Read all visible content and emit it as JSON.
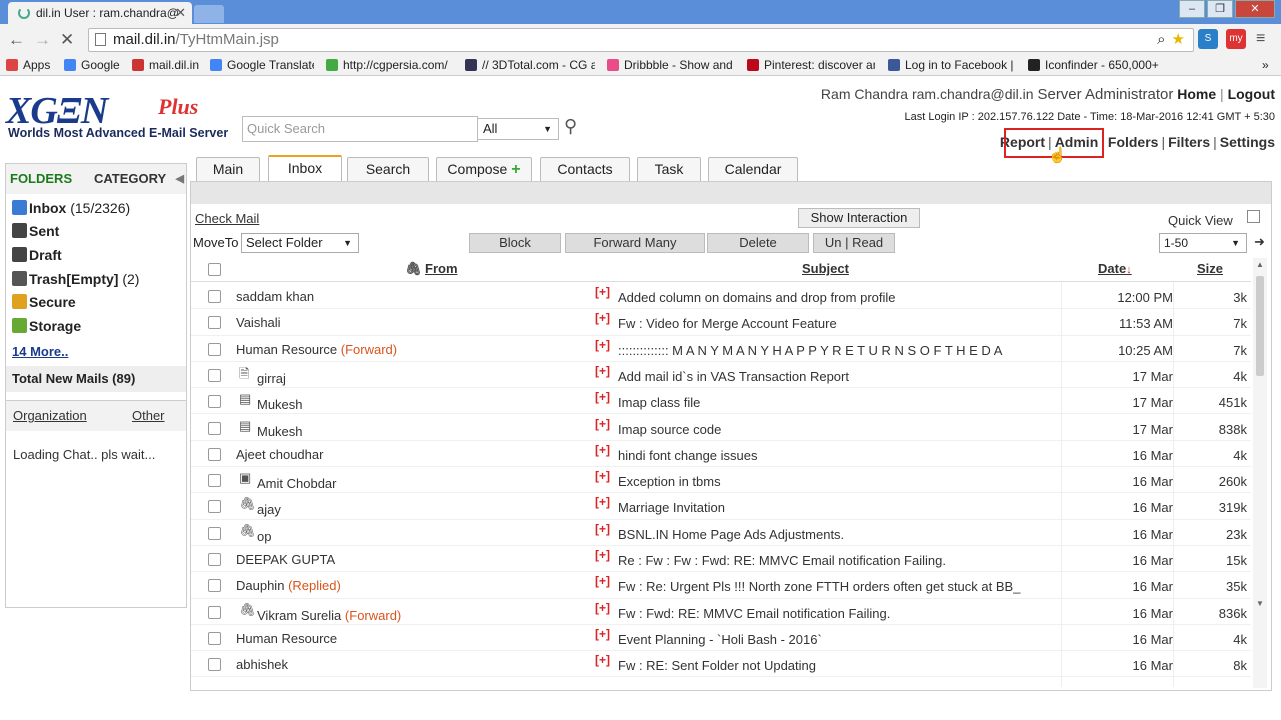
{
  "browser": {
    "tab_title": "dil.in User : ram.chandra@",
    "url_host": "mail.dil.in",
    "url_path": "/TyHtmMain.jsp",
    "ext_label": "my",
    "bookmarks": [
      {
        "label": "Apps",
        "color": "#d44"
      },
      {
        "label": "Google",
        "color": "#4285f4"
      },
      {
        "label": "mail.dil.in",
        "color": "#c33"
      },
      {
        "label": "Google Translate",
        "color": "#4285f4"
      },
      {
        "label": "http://cgpersia.com/",
        "color": "#4a4"
      },
      {
        "label": "// 3DTotal.com - CG a",
        "color": "#335"
      },
      {
        "label": "Dribbble - Show and",
        "color": "#ea4c89"
      },
      {
        "label": "Pinterest: discover anc",
        "color": "#bd081c"
      },
      {
        "label": "Log in to Facebook | F",
        "color": "#3b5998"
      },
      {
        "label": "Iconfinder - 650,000+",
        "color": "#222"
      }
    ]
  },
  "header": {
    "logo_text": "XGENPlus",
    "logo_tagline": "Worlds Most Advanced E-Mail Server",
    "search_placeholder": "Quick Search",
    "search_scope": "All",
    "user_name": "Ram Chandra",
    "user_email": "ram.chandra@dil.in",
    "user_role": "Server Administrator",
    "home_link": "Home",
    "logout_link": "Logout",
    "last_login": "Last Login IP : 202.157.76.122 Date - Time: 18-Mar-2016 12:41 GMT + 5:30",
    "links": [
      "Report",
      "Admin",
      "Folders",
      "Filters",
      "Settings"
    ]
  },
  "sidebar": {
    "folders_label": "FOLDERS",
    "category_label": "CATEGORY",
    "items": [
      {
        "name": "Inbox",
        "count": "(15/2326)",
        "color": "#3a7bd5"
      },
      {
        "name": "Sent",
        "count": "",
        "color": "#444"
      },
      {
        "name": "Draft",
        "count": "",
        "color": "#444"
      },
      {
        "name": "Trash[Empty]",
        "count": "(2)",
        "color": "#555"
      },
      {
        "name": "Secure",
        "count": "",
        "color": "#e0a020"
      },
      {
        "name": "Storage",
        "count": "",
        "color": "#6a3"
      }
    ],
    "more_link": "14 More..",
    "total_new": "Total New Mails (89)",
    "chat_tab_org": "Organization",
    "chat_tab_other": "Other",
    "chat_status": "Loading Chat.. pls wait..."
  },
  "tabs": [
    "Main",
    "Inbox",
    "Search",
    "Compose",
    "Contacts",
    "Task",
    "Calendar"
  ],
  "actions": {
    "check_mail": "Check Mail",
    "show_interaction": "Show Interaction",
    "quick_view": "Quick View",
    "move_to": "MoveTo",
    "select_folder": "Select Folder",
    "block": "Block",
    "forward_many": "Forward Many",
    "delete": "Delete",
    "un": "Un",
    "read": "Read",
    "page_range": "1-50"
  },
  "columns": {
    "from": "From",
    "subject": "Subject",
    "date": "Date",
    "size": "Size"
  },
  "messages": [
    {
      "from": "saddam khan",
      "tag": "",
      "icon": "",
      "subject": "Added column on domains and drop from profile",
      "date": "12:00 PM",
      "size": "3k"
    },
    {
      "from": "Vaishali",
      "tag": "",
      "icon": "",
      "subject": "Fw : Video for Merge Account Feature",
      "date": "11:53 AM",
      "size": "7k"
    },
    {
      "from": "Human Resource",
      "tag": "(Forward)",
      "icon": "",
      "subject": ":::::::::::::: M A N Y M A N Y H A P P Y R E T U R N S O F T H E D A",
      "date": "10:25 AM",
      "size": "7k"
    },
    {
      "from": "girraj",
      "tag": "",
      "icon": "doc",
      "subject": "Add mail id`s in VAS Transaction Report",
      "date": "17 Mar",
      "size": "4k"
    },
    {
      "from": "Mukesh",
      "tag": "",
      "icon": "zip",
      "subject": "Imap class file",
      "date": "17 Mar",
      "size": "451k"
    },
    {
      "from": "Mukesh",
      "tag": "",
      "icon": "zip",
      "subject": "Imap source code",
      "date": "17 Mar",
      "size": "838k"
    },
    {
      "from": "Ajeet choudhar",
      "tag": "",
      "icon": "",
      "subject": "hindi font change issues",
      "date": "16 Mar",
      "size": "4k"
    },
    {
      "from": "Amit Chobdar",
      "tag": "",
      "icon": "jpg",
      "subject": "Exception in tbms",
      "date": "16 Mar",
      "size": "260k"
    },
    {
      "from": "ajay",
      "tag": "",
      "icon": "clip",
      "subject": "Marriage Invitation",
      "date": "16 Mar",
      "size": "319k"
    },
    {
      "from": "op",
      "tag": "",
      "icon": "clip",
      "subject": "BSNL.IN Home Page Ads Adjustments.",
      "date": "16 Mar",
      "size": "23k"
    },
    {
      "from": "DEEPAK GUPTA",
      "tag": "",
      "icon": "",
      "subject": "Re : Fw : Fw : Fwd: RE: MMVC Email notification Failing.",
      "date": "16 Mar",
      "size": "15k"
    },
    {
      "from": "Dauphin",
      "tag": "(Replied)",
      "icon": "",
      "subject": "Fw : Re: Urgent Pls !!! North zone FTTH orders often get stuck at BB_",
      "date": "16 Mar",
      "size": "35k"
    },
    {
      "from": "Vikram Surelia",
      "tag": "(Forward)",
      "icon": "clip",
      "subject": "Fw : Fwd: RE: MMVC Email notification Failing.",
      "date": "16 Mar",
      "size": "836k"
    },
    {
      "from": "Human Resource",
      "tag": "",
      "icon": "",
      "subject": "Event Planning - `Holi Bash - 2016`",
      "date": "16 Mar",
      "size": "4k"
    },
    {
      "from": "abhishek",
      "tag": "",
      "icon": "",
      "subject": "Fw : RE: Sent Folder not Updating",
      "date": "16 Mar",
      "size": "8k"
    }
  ],
  "flag_text": "[+]"
}
